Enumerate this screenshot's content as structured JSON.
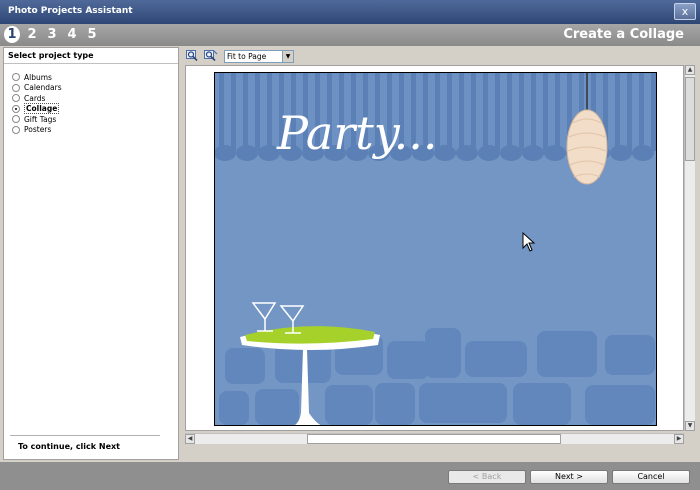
{
  "window": {
    "title": "Photo Projects Assistant",
    "close_glyph": "x"
  },
  "steps": {
    "items": [
      "1",
      "2",
      "3",
      "4",
      "5"
    ],
    "active_index": 0
  },
  "heading": "Create a Collage",
  "project_type": {
    "title": "Select project type",
    "options": [
      {
        "label": "Albums",
        "checked": false
      },
      {
        "label": "Calendars",
        "checked": false
      },
      {
        "label": "Cards",
        "checked": false
      },
      {
        "label": "Collage",
        "checked": true
      },
      {
        "label": "Gift Tags",
        "checked": false
      },
      {
        "label": "Posters",
        "checked": false
      }
    ],
    "hint": "To continue, click Next"
  },
  "toolbar": {
    "zoom_in_icon": "zoom-in-icon",
    "zoom_out_icon": "zoom-out-icon",
    "zoom_value": "Fit to Page"
  },
  "preview": {
    "party_text": "Party...",
    "background_color": "#7396c4",
    "stripe_color": "#5c82b8"
  },
  "buttons": {
    "back": "< Back",
    "next": "Next >",
    "cancel": "Cancel"
  }
}
